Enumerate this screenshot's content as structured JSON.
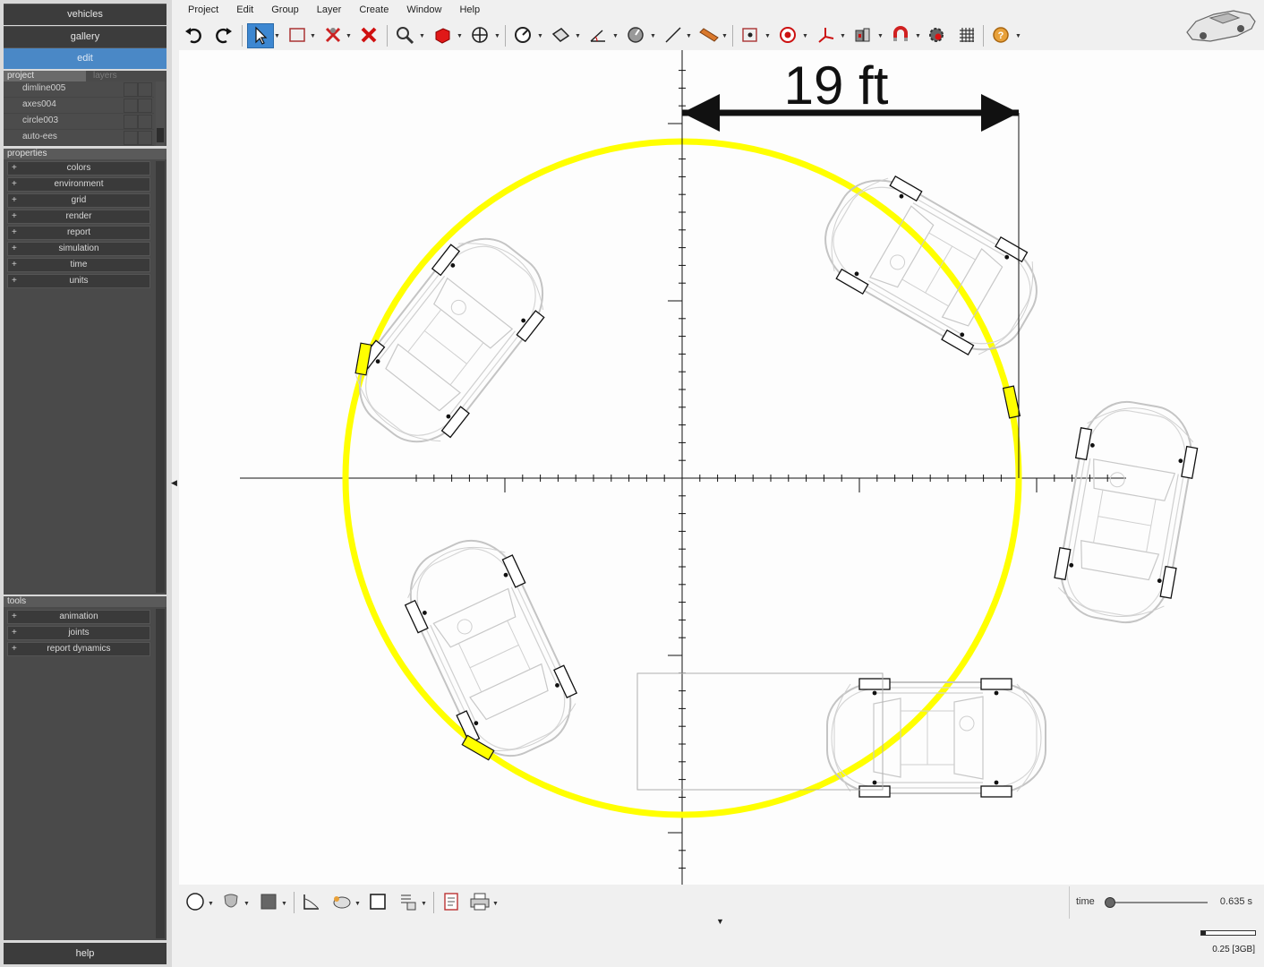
{
  "nav": {
    "vehicles": "vehicles",
    "gallery": "gallery",
    "edit": "edit",
    "help": "help"
  },
  "project_panel": {
    "tab_project": "project",
    "tab_layers": "layers",
    "items": [
      "dimline005",
      "axes004",
      "circle003",
      "auto-ees"
    ]
  },
  "properties": {
    "header": "properties",
    "items": [
      "colors",
      "environment",
      "grid",
      "render",
      "report",
      "simulation",
      "time",
      "units"
    ]
  },
  "tools": {
    "header": "tools",
    "items": [
      "animation",
      "joints",
      "report dynamics"
    ]
  },
  "menu": [
    "Project",
    "Edit",
    "Group",
    "Layer",
    "Create",
    "Window",
    "Help"
  ],
  "toolbar_icons": [
    "undo-icon",
    "redo-icon",
    "select-arrow-icon",
    "select-box-icon",
    "delete-special-icon",
    "delete-icon",
    "zoom-icon",
    "view-cube-icon",
    "pan-icon",
    "gauge-icon",
    "surface-icon",
    "angle-icon",
    "dial-icon",
    "line-icon",
    "ruler-icon",
    "point-select-icon",
    "target-icon",
    "axes-icon",
    "camera-mount-icon",
    "magnet-icon",
    "settings-icon",
    "grid-icon",
    "help-icon"
  ],
  "canvas": {
    "dimension_label": "19 ft",
    "circle_color": "#ffff00"
  },
  "bottom_icons": [
    "circle-shape-icon",
    "shield-shape-icon",
    "fill-color-icon",
    "graph-icon",
    "animal-icon",
    "rectangle-icon",
    "layers-icon",
    "report-icon",
    "print-icon"
  ],
  "time": {
    "label": "time",
    "value": "0.635 s",
    "slider_fraction": 0.0
  },
  "status": {
    "memory": "0.25 [3GB]"
  }
}
